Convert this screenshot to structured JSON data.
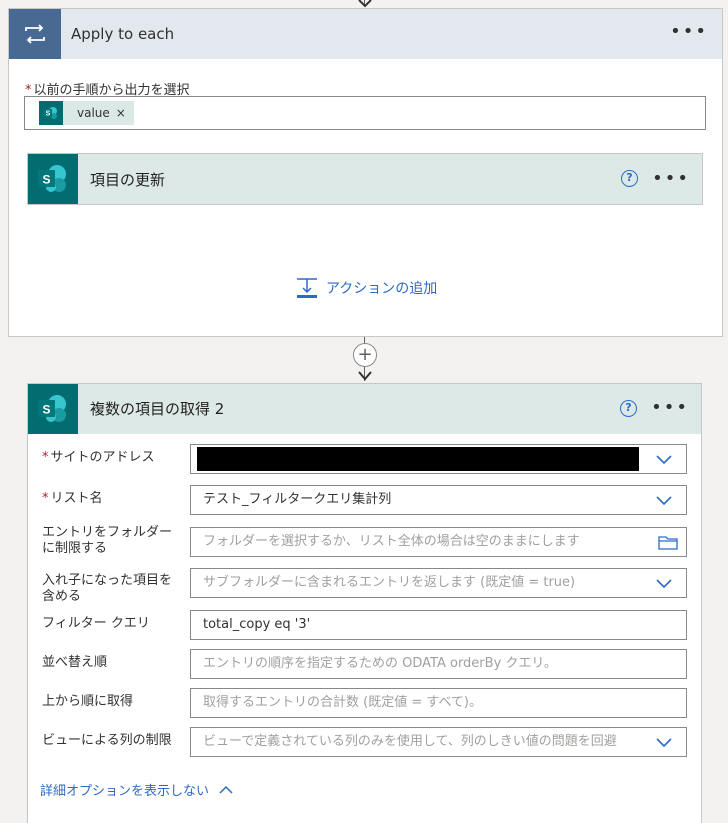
{
  "apply_each": {
    "title": "Apply to each",
    "select_label": "以前の手順から出力を選択",
    "token_label": "value",
    "token_remove": "×",
    "icon": "loop-icon"
  },
  "update_item": {
    "title": "項目の更新",
    "help": "?",
    "icon": "sharepoint-icon"
  },
  "add_action": {
    "label": "アクションの追加",
    "icon": "add-action-icon"
  },
  "get_items": {
    "title": "複数の項目の取得 2",
    "help": "?",
    "icon": "sharepoint-icon",
    "fields": {
      "site": {
        "label": "サイトのアドレス",
        "value": ""
      },
      "list": {
        "label": "リスト名",
        "value": "テスト_フィルタークエリ集計列"
      },
      "folder": {
        "label1": "エントリをフォルダー",
        "label2": "に制限する",
        "placeholder": "フォルダーを選択するか、リスト全体の場合は空のままにします"
      },
      "nested": {
        "label1": "入れ子になった項目を",
        "label2": "含める",
        "placeholder": "サブフォルダーに含まれるエントリを返します (既定値 = true)"
      },
      "filter": {
        "label": "フィルター クエリ",
        "value": "total_copy eq '3'"
      },
      "orderby": {
        "label": "並べ替え順",
        "placeholder": "エントリの順序を指定するための ODATA orderBy クエリ。"
      },
      "top": {
        "label": "上から順に取得",
        "placeholder": "取得するエントリの合計数 (既定値 = すべて)。"
      },
      "view": {
        "label": "ビューによる列の制限",
        "placeholder": "ビューで定義されている列のみを使用して、列のしきい値の問題を回避"
      }
    },
    "advanced_toggle": "詳細オプションを表示しない"
  },
  "colors": {
    "loop_header": "#486991",
    "sharepoint": "#036c70",
    "link": "#2b6bc5",
    "required": "#a4262c"
  }
}
